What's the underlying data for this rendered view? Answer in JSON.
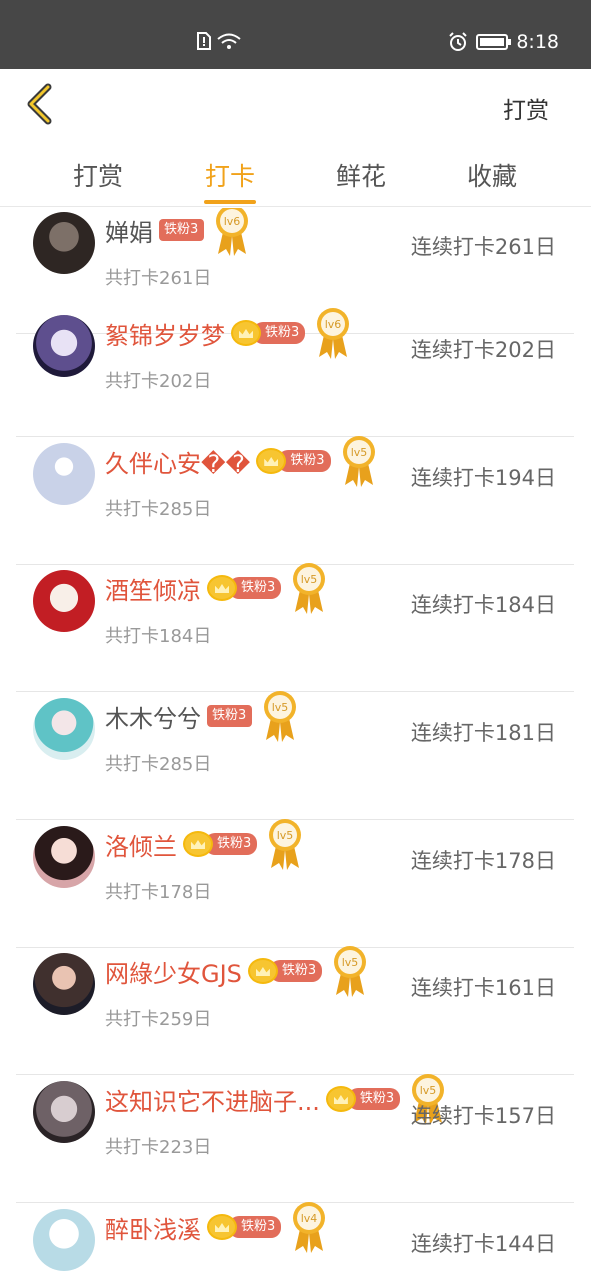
{
  "status_bar": {
    "time": "8:18"
  },
  "header": {
    "action_label": "打赏"
  },
  "tabs": [
    {
      "label": "打赏"
    },
    {
      "label": "打卡"
    },
    {
      "label": "鲜花"
    },
    {
      "label": "收藏"
    }
  ],
  "rows": [
    {
      "name": "婵娟",
      "name_color": "plain",
      "has_crown": false,
      "fan_badge": "铁粉3",
      "level": "lv6",
      "total": "共打卡261日",
      "streak": "连续打卡261日"
    },
    {
      "name": "絮锦岁岁梦",
      "name_color": "red",
      "has_crown": true,
      "fan_badge": "铁粉3",
      "level": "lv6",
      "total": "共打卡202日",
      "streak": "连续打卡202日"
    },
    {
      "name": "久伴心安��",
      "name_color": "red",
      "has_crown": true,
      "fan_badge": "铁粉3",
      "level": "lv5",
      "total": "共打卡285日",
      "streak": "连续打卡194日"
    },
    {
      "name": "酒笙倾凉",
      "name_color": "red",
      "has_crown": true,
      "fan_badge": "铁粉3",
      "level": "lv5",
      "total": "共打卡184日",
      "streak": "连续打卡184日"
    },
    {
      "name": "木木兮兮",
      "name_color": "plain",
      "has_crown": false,
      "fan_badge": "铁粉3",
      "level": "lv5",
      "total": "共打卡285日",
      "streak": "连续打卡181日"
    },
    {
      "name": "洛倾兰",
      "name_color": "red",
      "has_crown": true,
      "fan_badge": "铁粉3",
      "level": "lv5",
      "total": "共打卡178日",
      "streak": "连续打卡178日"
    },
    {
      "name": "网綠少女GJS",
      "name_color": "red",
      "has_crown": true,
      "fan_badge": "铁粉3",
      "level": "lv5",
      "total": "共打卡259日",
      "streak": "连续打卡161日"
    },
    {
      "name": "这知识它不进脑子...",
      "name_color": "red",
      "has_crown": true,
      "fan_badge": "铁粉3",
      "level": "lv5",
      "total": "共打卡223日",
      "streak": "连续打卡157日"
    },
    {
      "name": "醉卧浅溪",
      "name_color": "red",
      "has_crown": true,
      "fan_badge": "铁粉3",
      "level": "lv4",
      "total": "",
      "streak": "连续打卡144日"
    }
  ]
}
